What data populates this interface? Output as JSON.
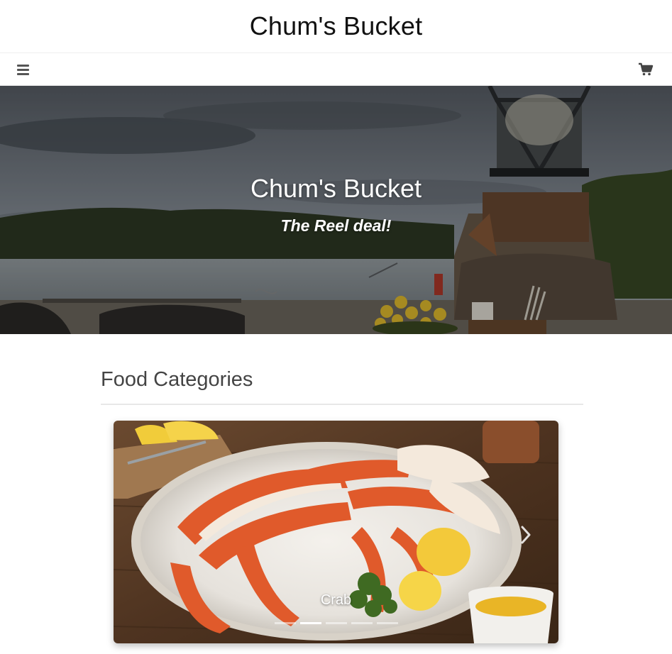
{
  "header": {
    "title": "Chum's Bucket"
  },
  "navbar": {
    "menu_icon": "hamburger-menu-icon",
    "cart_icon": "shopping-cart-icon"
  },
  "hero": {
    "title": "Chum's Bucket",
    "tagline": "The Reel deal!"
  },
  "categories": {
    "heading": "Food Categories",
    "carousel": {
      "active_caption": "Crab",
      "slide_count": 5,
      "active_index": 1,
      "next_icon": "chevron-right-icon"
    }
  }
}
